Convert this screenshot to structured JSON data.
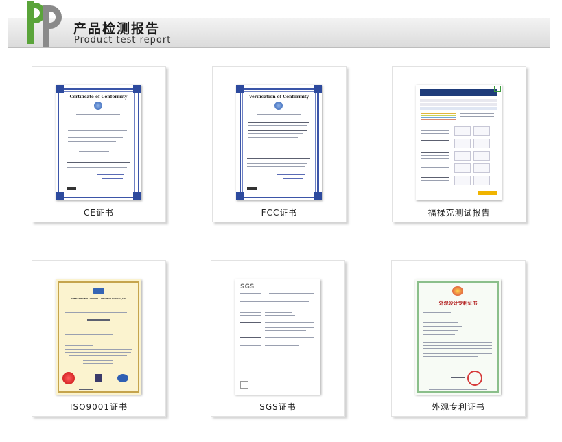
{
  "header": {
    "title_cn": "产品检测报告",
    "title_en": "Product test report",
    "logo_colors": {
      "primary": "#5aa43a",
      "secondary": "#8a8a8a"
    }
  },
  "cards": [
    {
      "caption": "CE证书",
      "doc_title": "Certificate of Conformity"
    },
    {
      "caption": "FCC证书",
      "doc_title": "Verification of Conformity"
    },
    {
      "caption": "福禄克测试报告"
    },
    {
      "caption": "ISO9001证书",
      "doc_title": "SHENZHEN MILLIONWELL TECHNOLOGY CO.,LTD"
    },
    {
      "caption": "SGS证书",
      "doc_title": "SGS"
    },
    {
      "caption": "外观专利证书",
      "doc_title": "外观设计专利证书"
    }
  ]
}
